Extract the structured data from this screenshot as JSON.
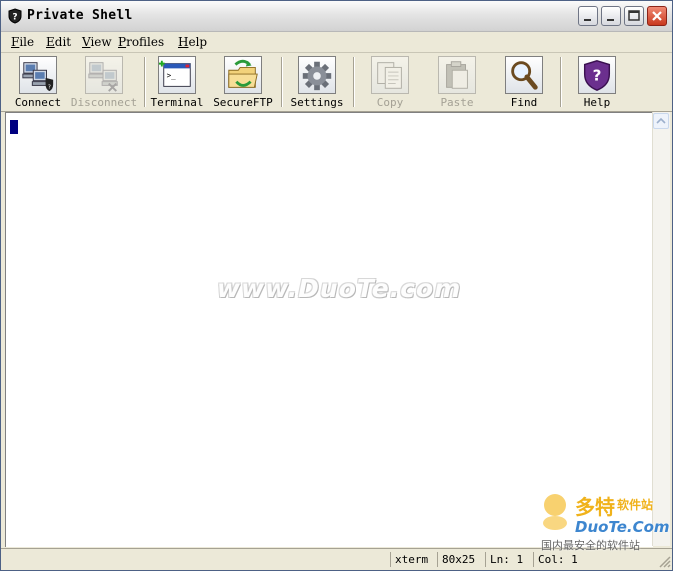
{
  "window": {
    "title": "Private Shell"
  },
  "menu": [
    {
      "label": "File"
    },
    {
      "label": "Edit"
    },
    {
      "label": "View"
    },
    {
      "label": "Profiles"
    },
    {
      "label": "Help"
    }
  ],
  "toolbar": [
    {
      "label": "Connect",
      "icon": "computers-connect-icon",
      "enabled": true
    },
    {
      "label": "Disconnect",
      "icon": "computers-disconnect-icon",
      "enabled": false
    },
    {
      "label": "Terminal",
      "icon": "terminal-icon",
      "enabled": true
    },
    {
      "label": "SecureFTP",
      "icon": "folder-ftp-icon",
      "enabled": true
    },
    {
      "label": "Settings",
      "icon": "gear-icon",
      "enabled": true
    },
    {
      "label": "Copy",
      "icon": "copy-icon",
      "enabled": false
    },
    {
      "label": "Paste",
      "icon": "paste-icon",
      "enabled": false
    },
    {
      "label": "Find",
      "icon": "magnifier-icon",
      "enabled": true
    },
    {
      "label": "Help",
      "icon": "help-shield-icon",
      "enabled": true
    }
  ],
  "status": {
    "terminal_type": "xterm",
    "dimensions": "80x25",
    "line": "Ln: 1",
    "column": "Col: 1"
  },
  "watermark": {
    "text": "www.DuoTe.com"
  },
  "corner_logo": {
    "brand": "多特",
    "brand_suffix": "软件站",
    "site": "DuoTe.Com",
    "slogan": "国内最安全的软件站"
  },
  "colors": {
    "cursor": "#000080",
    "close_button": "#c9391f",
    "titlebar": "#e4e4e4"
  }
}
